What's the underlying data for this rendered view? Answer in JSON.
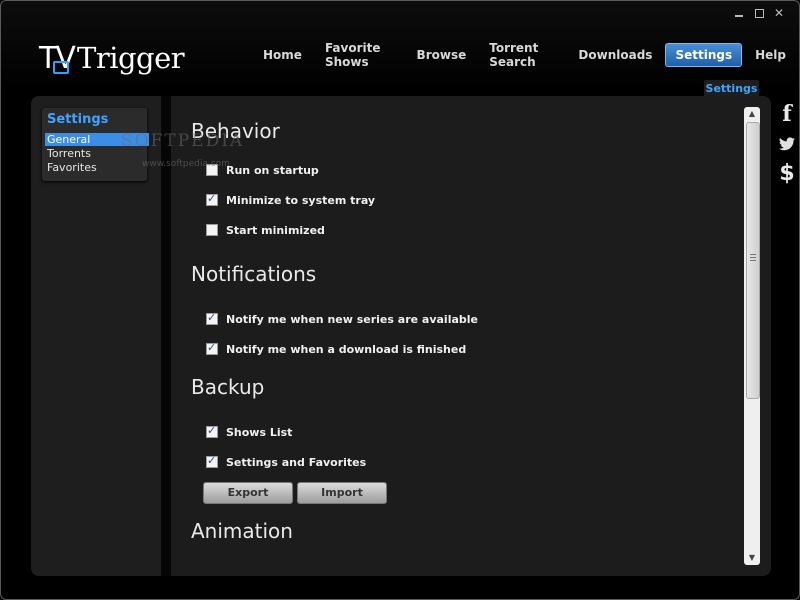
{
  "app": {
    "logo_tv": "TV",
    "logo_brand": "Trigger"
  },
  "nav": {
    "items": [
      "Home",
      "Favorite Shows",
      "Browse",
      "Torrent Search",
      "Downloads",
      "Settings",
      "Help"
    ],
    "active_index": 5
  },
  "page_tab": "Settings",
  "sidebar": {
    "title": "Settings",
    "items": [
      "General",
      "Torrents",
      "Favorites"
    ],
    "selected": "General"
  },
  "sections": {
    "behavior": {
      "title": "Behavior",
      "options": [
        {
          "label": "Run on startup",
          "checked": false
        },
        {
          "label": "Minimize to system tray",
          "checked": true
        },
        {
          "label": "Start minimized",
          "checked": false
        }
      ]
    },
    "notifications": {
      "title": "Notifications",
      "options": [
        {
          "label": "Notify me when new series are available",
          "checked": true
        },
        {
          "label": "Notify me when a download is finished",
          "checked": true
        }
      ]
    },
    "backup": {
      "title": "Backup",
      "options": [
        {
          "label": "Shows List",
          "checked": true
        },
        {
          "label": "Settings and Favorites",
          "checked": true
        }
      ],
      "export_label": "Export",
      "import_label": "Import"
    },
    "animation": {
      "title": "Animation"
    }
  },
  "social": {
    "facebook_icon": "facebook-icon",
    "twitter_icon": "twitter-icon",
    "donate_icon": "dollar-icon"
  },
  "watermark": {
    "main": "SOFTPEDIA",
    "url": "www.softpedia.com"
  },
  "colors": {
    "accent": "#3fa4ff",
    "selection": "#3b8ee6",
    "background": "#000000",
    "panel": "#1c1c1c"
  }
}
